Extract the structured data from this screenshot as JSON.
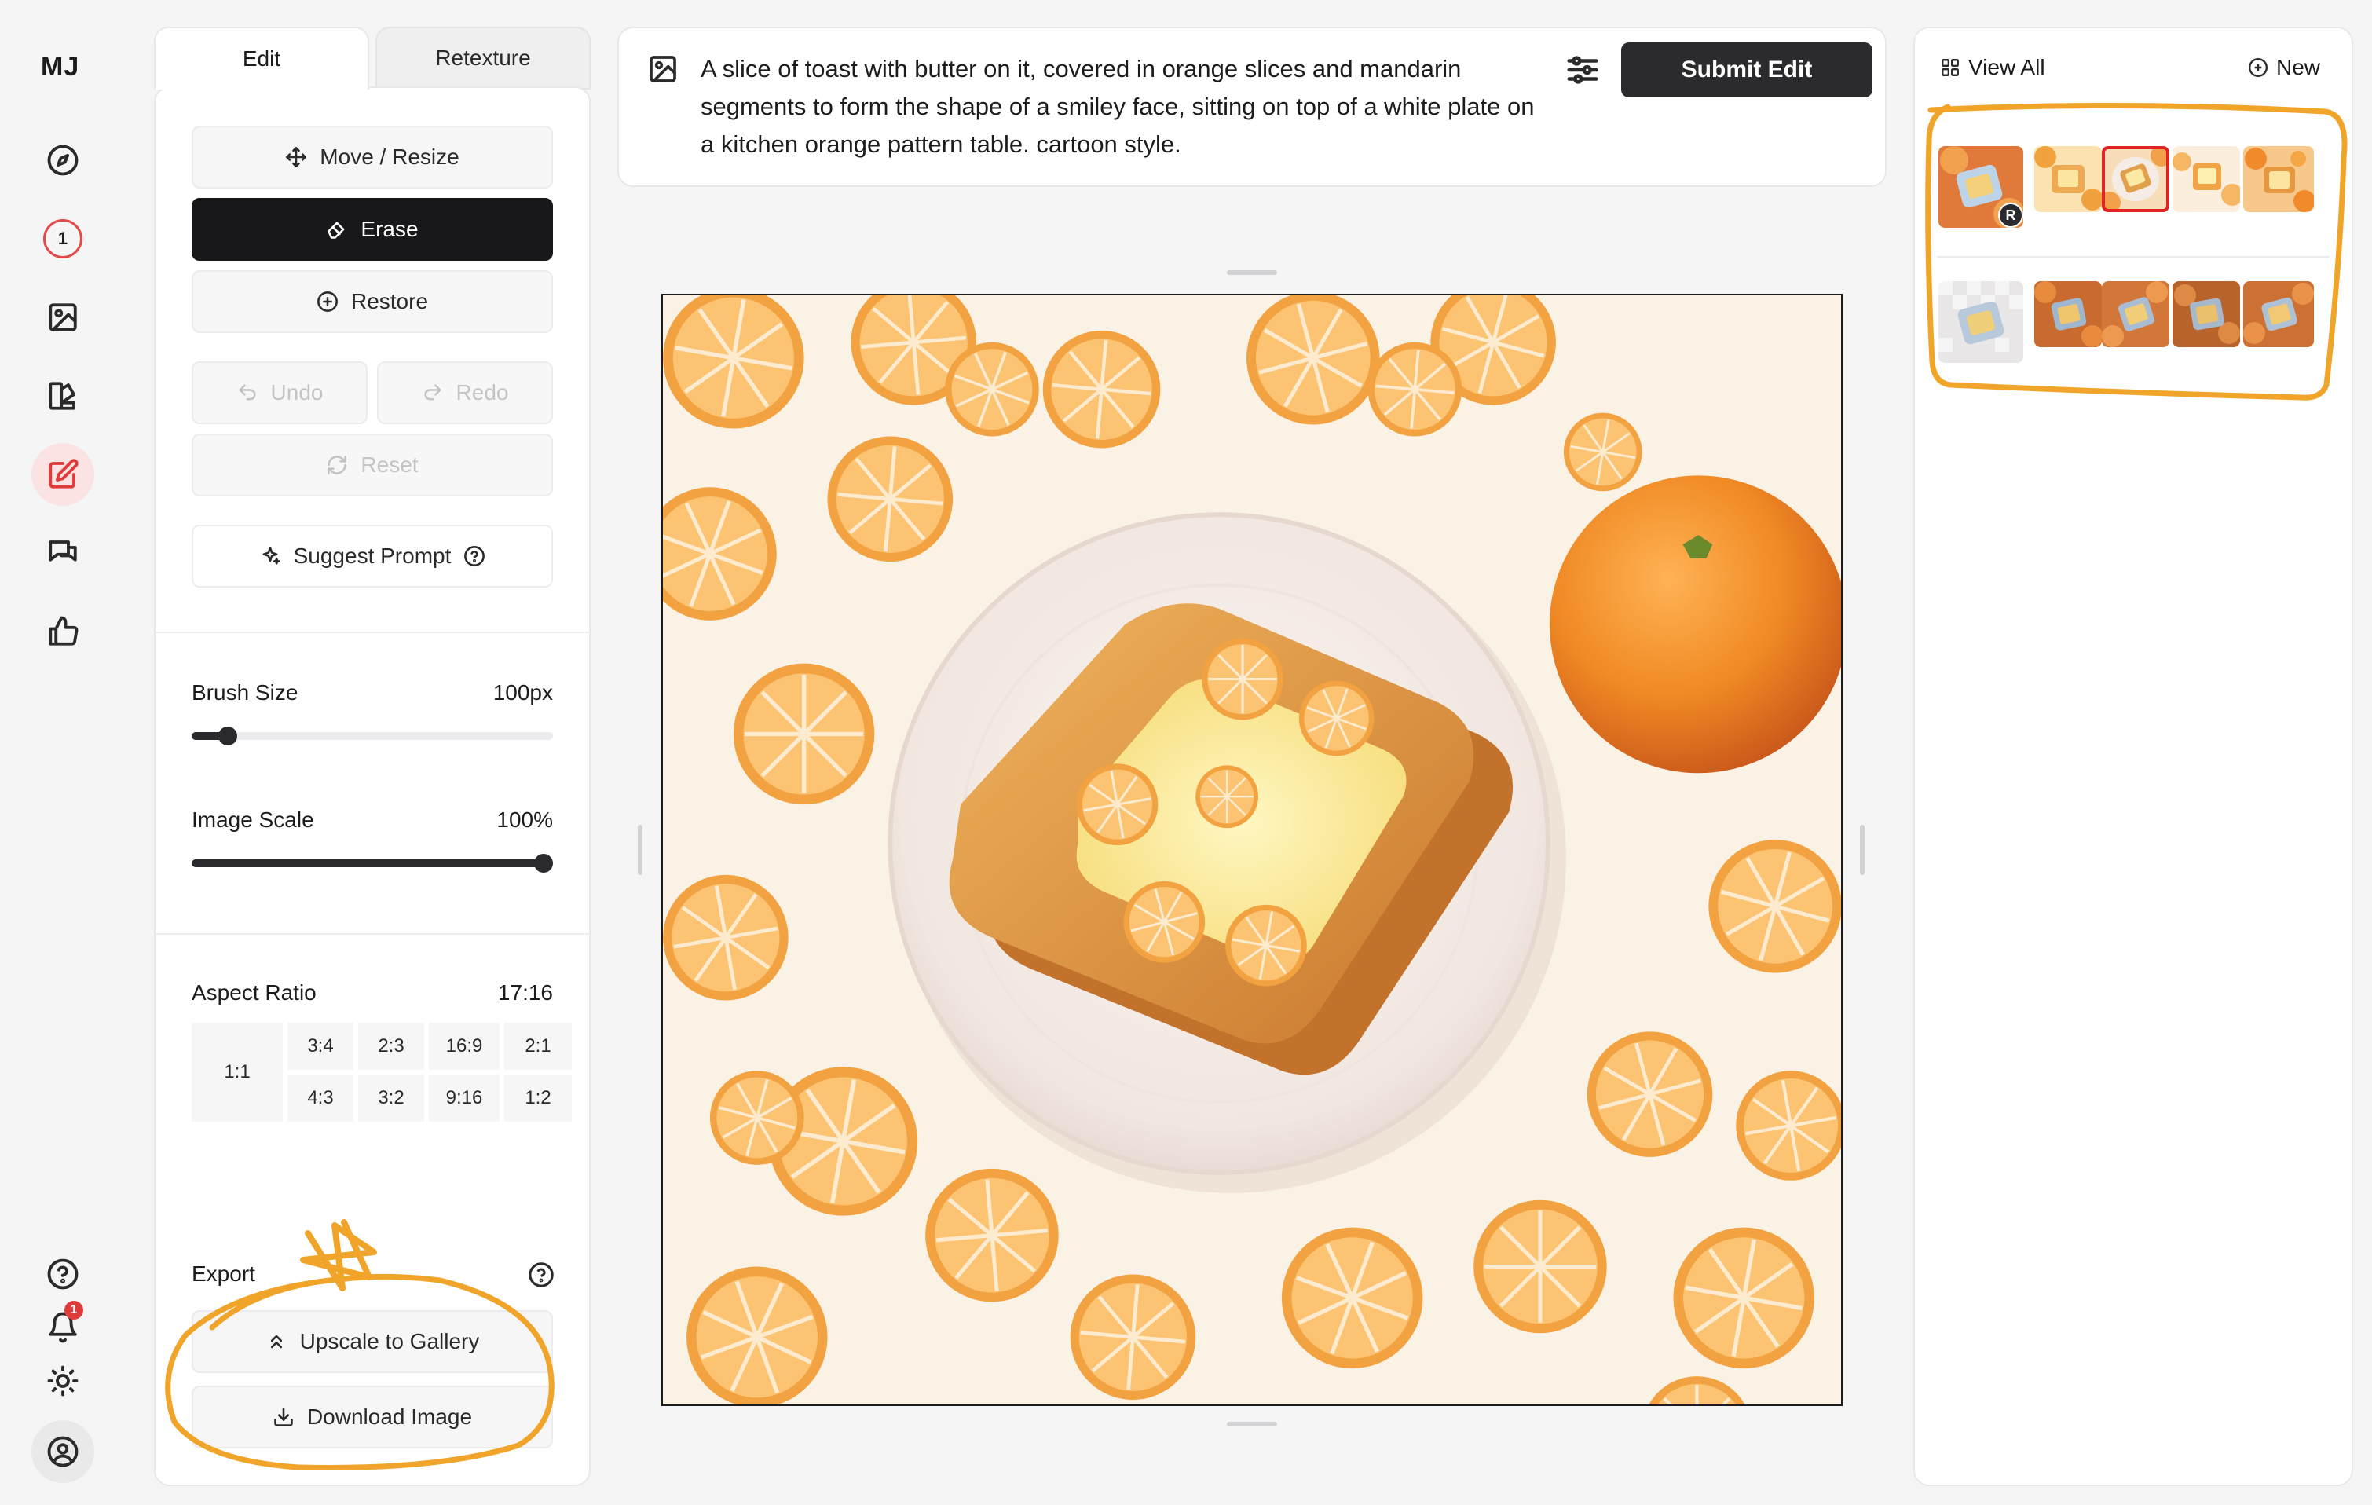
{
  "app": {
    "logo": "MJ"
  },
  "rail": {
    "icons": [
      "compass-icon",
      "numbered-badge-icon",
      "image-icon",
      "brush-palette-icon",
      "edit-icon",
      "chat-icon",
      "thumbs-up-icon",
      "help-icon",
      "bell-icon",
      "sun-icon",
      "account-icon"
    ],
    "badge_number": "1",
    "notification_count": "1"
  },
  "panel": {
    "tabs": {
      "edit": "Edit",
      "retexture": "Retexture"
    },
    "tools": {
      "move_resize": "Move / Resize",
      "erase": "Erase",
      "restore": "Restore",
      "undo": "Undo",
      "redo": "Redo",
      "reset": "Reset",
      "suggest_prompt": "Suggest Prompt"
    },
    "brush_size": {
      "label": "Brush Size",
      "value": "100px",
      "fraction": 0.1
    },
    "image_scale": {
      "label": "Image Scale",
      "value": "100%",
      "fraction": 1.0
    },
    "aspect_ratio": {
      "label": "Aspect Ratio",
      "value": "17:16",
      "options": [
        "1:1",
        "3:4",
        "2:3",
        "16:9",
        "2:1",
        "4:3",
        "3:2",
        "9:16",
        "1:2"
      ]
    },
    "export": {
      "label": "Export",
      "upscale": "Upscale to Gallery",
      "download": "Download Image"
    }
  },
  "prompt": {
    "text": "A slice of toast with butter on it, covered in orange slices and mandarin segments to form the shape of a smiley face, sitting on top of a white plate on a kitchen orange pattern table. cartoon style.",
    "submit": "Submit Edit"
  },
  "gallery": {
    "view_all": "View All",
    "new": "New",
    "ref_badge": "R",
    "rows": [
      {
        "thumbs": 5,
        "selected_index": 2
      },
      {
        "thumbs": 5,
        "selected_index": -1
      }
    ]
  },
  "colors": {
    "accent_red": "#e03b3b",
    "highlight_orange": "#f0a52a",
    "dark_button": "#18181a",
    "orange_fruit": "#f08a24"
  }
}
